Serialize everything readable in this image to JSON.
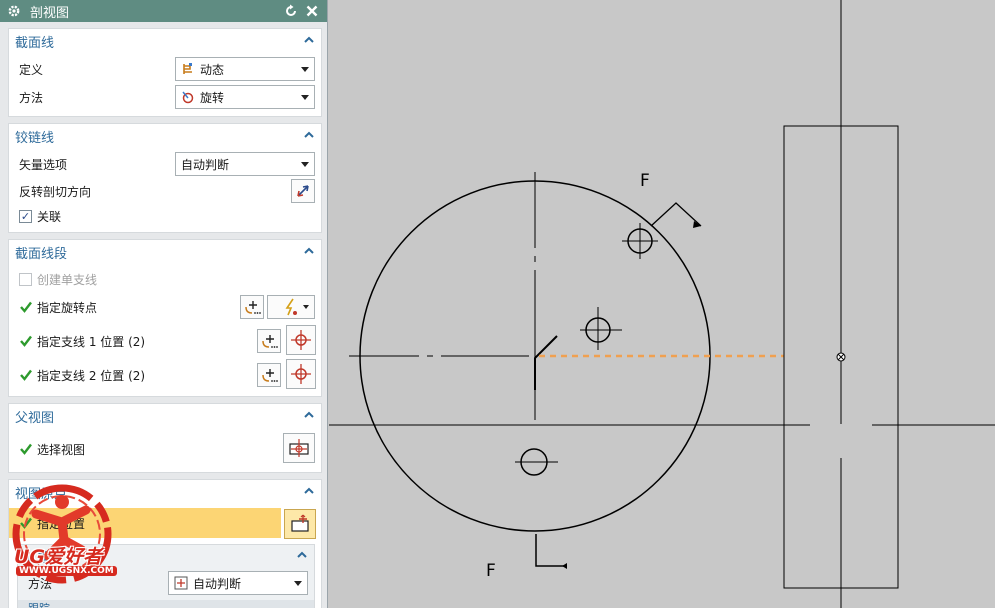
{
  "dialog": {
    "title": "剖视图"
  },
  "sec_line": {
    "header": "截面线",
    "define_label": "定义",
    "define_value": "动态",
    "method_label": "方法",
    "method_value": "旋转"
  },
  "hinge": {
    "header": "铰链线",
    "vector_label": "矢量选项",
    "vector_value": "自动判断",
    "reverse_label": "反转剖切方向",
    "assoc_label": "关联"
  },
  "segment": {
    "header": "截面线段",
    "single_label": "创建单支线",
    "rot_point_label": "指定旋转点",
    "branch1_label": "指定支线 1 位置 (2)",
    "branch2_label": "指定支线 2 位置 (2)"
  },
  "parent": {
    "header": "父视图",
    "select_label": "选择视图"
  },
  "origin": {
    "header": "视图原点",
    "location_label": "指定位置",
    "sub_header": "放置",
    "method_label": "方法",
    "method_value": "自动判断",
    "next_header": "跟踪"
  },
  "watermark": {
    "brand": "UG爱好者",
    "url": "WWW.UGSNX.COM"
  },
  "drawing": {
    "section_label_top": "F",
    "section_label_bottom": "F",
    "dash_color": "#f0a050"
  }
}
